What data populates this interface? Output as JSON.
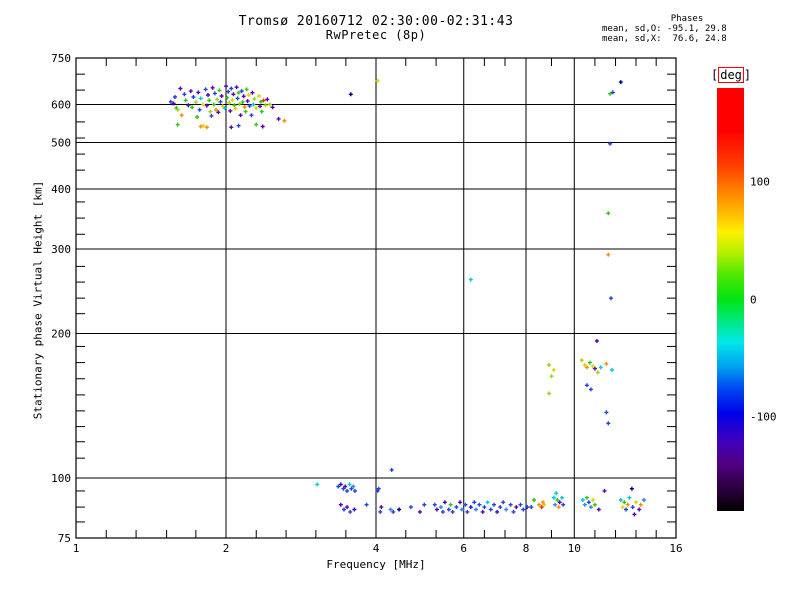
{
  "header": {
    "title_line1": "Tromsø 20160712 02:30:00-02:31:43",
    "title_line2": "RwPretec (8p)",
    "phases": {
      "heading": "Phases",
      "line_o": "mean, sd,O: -95.1, 29.8",
      "line_x": "mean, sd,X:  76.6, 24.8"
    }
  },
  "chart_data": {
    "type": "scatter",
    "title": "Tromsø 20160712 02:30:00-02:31:43",
    "subtitle": "RwPretec (8p)",
    "xlabel": "Frequency [MHz]",
    "ylabel": "Stationary phase Virtual Height [km]",
    "x_scale": "log",
    "y_scale": "log",
    "xlim": [
      1,
      16
    ],
    "ylim": [
      75,
      750
    ],
    "grid": true,
    "x_major_ticks": [
      1,
      2,
      4,
      6,
      8,
      10,
      16
    ],
    "x_minor_ticks": [
      1.15,
      1.32,
      1.52,
      1.74,
      2.3,
      2.64,
      3.03,
      3.48,
      4.59,
      5.28,
      6.6,
      7.26,
      9,
      11,
      12.1,
      13.3,
      14.6
    ],
    "y_major_ticks": [
      750,
      600,
      500,
      400,
      300,
      200,
      100,
      75
    ],
    "y_minor_ticks": [
      694,
      643,
      552,
      511,
      473,
      438,
      376,
      348,
      322,
      276,
      256,
      237,
      220,
      188,
      174,
      161,
      149,
      138,
      128,
      119,
      110,
      94,
      87,
      81
    ],
    "colorbar": {
      "label": "[deg]",
      "unit": "deg",
      "range": [
        -180,
        180
      ],
      "ticks": [
        100,
        0,
        -100
      ],
      "gradient": [
        "#ff0000 0%",
        "#ff0000 10%",
        "#ff3c00 18%",
        "#ff7d00 24%",
        "#ffc000 30%",
        "#fff000 34%",
        "#b4f000 39%",
        "#50e800 44%",
        "#00e414 50%",
        "#00e87d 55%",
        "#00e8e8 60%",
        "#00a0f0 66%",
        "#0048f0 71%",
        "#0000e8 77%",
        "#3c00c0 83%",
        "#500080 89%",
        "#28003c 95%",
        "#000000 100%"
      ]
    },
    "marker": "plus",
    "colors": {
      "p": "#5c00b0",
      "i": "#2a10c8",
      "b": "#2442dd",
      "lb": "#2e86ee",
      "c": "#00c8e0",
      "g": "#2ec812",
      "yg": "#9cd611",
      "y": "#ddd300",
      "o": "#ff8c00",
      "r": "#e83200",
      "d": "#000080"
    },
    "series": [
      {
        "name": "stationary-phase-echoes",
        "points": [
          [
            1.55,
            608,
            "b"
          ],
          [
            1.57,
            603,
            "p"
          ],
          [
            1.58,
            622,
            "b"
          ],
          [
            1.59,
            590,
            "g"
          ],
          [
            1.6,
            585,
            "yg"
          ],
          [
            1.6,
            545,
            "g"
          ],
          [
            1.62,
            648,
            "p"
          ],
          [
            1.63,
            570,
            "o"
          ],
          [
            1.65,
            630,
            "b"
          ],
          [
            1.66,
            612,
            "g"
          ],
          [
            1.68,
            598,
            "p"
          ],
          [
            1.7,
            640,
            "p"
          ],
          [
            1.71,
            592,
            "g"
          ],
          [
            1.72,
            622,
            "b"
          ],
          [
            1.74,
            607,
            "yg"
          ],
          [
            1.75,
            565,
            "g"
          ],
          [
            1.76,
            636,
            "p"
          ],
          [
            1.77,
            585,
            "b"
          ],
          [
            1.78,
            618,
            "c"
          ],
          [
            1.78,
            540,
            "o"
          ],
          [
            1.8,
            600,
            "y"
          ],
          [
            1.8,
            542,
            "y"
          ],
          [
            1.82,
            645,
            "b"
          ],
          [
            1.83,
            597,
            "p"
          ],
          [
            1.83,
            538,
            "o"
          ],
          [
            1.84,
            628,
            "p"
          ],
          [
            1.85,
            612,
            "g"
          ],
          [
            1.86,
            580,
            "yg"
          ],
          [
            1.87,
            568,
            "b"
          ],
          [
            1.88,
            650,
            "p"
          ],
          [
            1.89,
            600,
            "g"
          ],
          [
            1.9,
            633,
            "b"
          ],
          [
            1.91,
            585,
            "o"
          ],
          [
            1.92,
            615,
            "yg"
          ],
          [
            1.93,
            578,
            "p"
          ],
          [
            1.94,
            642,
            "g"
          ],
          [
            1.95,
            608,
            "b"
          ],
          [
            1.96,
            625,
            "p"
          ],
          [
            1.97,
            595,
            "y"
          ],
          [
            1.99,
            590,
            "c"
          ],
          [
            2.0,
            655,
            "p"
          ],
          [
            2.01,
            620,
            "g"
          ],
          [
            2.02,
            638,
            "b"
          ],
          [
            2.03,
            605,
            "yg"
          ],
          [
            2.04,
            582,
            "p"
          ],
          [
            2.05,
            648,
            "b"
          ],
          [
            2.05,
            538,
            "p"
          ],
          [
            2.06,
            613,
            "y"
          ],
          [
            2.07,
            630,
            "p"
          ],
          [
            2.08,
            598,
            "g"
          ],
          [
            2.09,
            588,
            "y"
          ],
          [
            2.1,
            652,
            "p"
          ],
          [
            2.11,
            618,
            "b"
          ],
          [
            2.12,
            635,
            "g"
          ],
          [
            2.12,
            542,
            "b"
          ],
          [
            2.13,
            602,
            "yg"
          ],
          [
            2.14,
            570,
            "p"
          ],
          [
            2.15,
            640,
            "b"
          ],
          [
            2.16,
            607,
            "g"
          ],
          [
            2.17,
            624,
            "p"
          ],
          [
            2.18,
            593,
            "o"
          ],
          [
            2.19,
            580,
            "g"
          ],
          [
            2.2,
            645,
            "g"
          ],
          [
            2.21,
            610,
            "p"
          ],
          [
            2.22,
            628,
            "y"
          ],
          [
            2.23,
            596,
            "b"
          ],
          [
            2.25,
            570,
            "b"
          ],
          [
            2.26,
            635,
            "p"
          ],
          [
            2.27,
            600,
            "c"
          ],
          [
            2.28,
            616,
            "yg"
          ],
          [
            2.3,
            590,
            "y"
          ],
          [
            2.3,
            545,
            "g"
          ],
          [
            2.33,
            625,
            "y"
          ],
          [
            2.34,
            595,
            "p"
          ],
          [
            2.35,
            608,
            "g"
          ],
          [
            2.36,
            580,
            "g"
          ],
          [
            2.37,
            540,
            "p"
          ],
          [
            2.38,
            612,
            "r"
          ],
          [
            2.4,
            598,
            "yg"
          ],
          [
            2.42,
            615,
            "p"
          ],
          [
            2.45,
            600,
            "yg"
          ],
          [
            2.48,
            592,
            "p"
          ],
          [
            2.55,
            560,
            "p"
          ],
          [
            2.62,
            555,
            "o"
          ],
          [
            3.56,
            630,
            "d"
          ],
          [
            4.03,
            672,
            "y"
          ],
          [
            6.2,
            259,
            "c"
          ],
          [
            12.4,
            668,
            "d"
          ],
          [
            11.8,
            632,
            "g"
          ],
          [
            11.95,
            636,
            "b"
          ],
          [
            11.8,
            497,
            "b"
          ],
          [
            11.7,
            356,
            "g"
          ],
          [
            11.7,
            292,
            "o"
          ],
          [
            11.85,
            237,
            "b"
          ],
          [
            11.1,
            193,
            "p"
          ],
          [
            8.9,
            172,
            "yg"
          ],
          [
            9.1,
            168,
            "y"
          ],
          [
            9.0,
            163,
            "yg"
          ],
          [
            8.9,
            150,
            "yg"
          ],
          [
            10.35,
            176,
            "yg"
          ],
          [
            10.5,
            172,
            "y"
          ],
          [
            10.6,
            170,
            "o"
          ],
          [
            10.75,
            174,
            "g"
          ],
          [
            10.9,
            171,
            "y"
          ],
          [
            11.0,
            169,
            "p"
          ],
          [
            11.15,
            166,
            "yg"
          ],
          [
            11.3,
            170,
            "c"
          ],
          [
            11.6,
            173,
            "o"
          ],
          [
            11.9,
            168,
            "c"
          ],
          [
            10.6,
            156,
            "b"
          ],
          [
            10.8,
            153,
            "b"
          ],
          [
            11.6,
            137,
            "b"
          ],
          [
            11.7,
            130,
            "b"
          ],
          [
            3.05,
            97,
            "c"
          ],
          [
            3.36,
            96,
            "b"
          ],
          [
            3.4,
            97,
            "i"
          ],
          [
            3.44,
            95,
            "b"
          ],
          [
            3.47,
            96,
            "p"
          ],
          [
            3.5,
            94,
            "b"
          ],
          [
            3.54,
            97,
            "c"
          ],
          [
            3.57,
            95,
            "b"
          ],
          [
            3.6,
            96,
            "lb"
          ],
          [
            3.63,
            94,
            "b"
          ],
          [
            3.4,
            88,
            "p"
          ],
          [
            3.45,
            86,
            "b"
          ],
          [
            3.5,
            87,
            "p"
          ],
          [
            3.55,
            85,
            "b"
          ],
          [
            3.62,
            86,
            "i"
          ],
          [
            3.83,
            88,
            "b"
          ],
          [
            4.03,
            94,
            "b"
          ],
          [
            4.05,
            95,
            "b"
          ],
          [
            4.3,
            104,
            "b"
          ],
          [
            4.1,
            87,
            "p"
          ],
          [
            4.08,
            85,
            "b"
          ],
          [
            4.28,
            86,
            "lb"
          ],
          [
            4.33,
            85,
            "b"
          ],
          [
            4.45,
            86,
            "d"
          ],
          [
            4.7,
            87,
            "b"
          ],
          [
            4.9,
            85,
            "p"
          ],
          [
            5.0,
            88,
            "b"
          ],
          [
            5.25,
            88,
            "b"
          ],
          [
            5.3,
            86,
            "p"
          ],
          [
            5.4,
            87,
            "lb"
          ],
          [
            5.45,
            85,
            "b"
          ],
          [
            5.5,
            89,
            "i"
          ],
          [
            5.6,
            86,
            "b"
          ],
          [
            5.65,
            88,
            "g"
          ],
          [
            5.7,
            85,
            "b"
          ],
          [
            5.8,
            87,
            "b"
          ],
          [
            5.9,
            89,
            "p"
          ],
          [
            5.95,
            86,
            "lb"
          ],
          [
            6.05,
            88,
            "b"
          ],
          [
            6.1,
            85,
            "b"
          ],
          [
            6.2,
            87,
            "i"
          ],
          [
            6.3,
            89,
            "b"
          ],
          [
            6.35,
            86,
            "lb"
          ],
          [
            6.45,
            88,
            "b"
          ],
          [
            6.55,
            85,
            "p"
          ],
          [
            6.6,
            87,
            "b"
          ],
          [
            6.7,
            89,
            "c"
          ],
          [
            6.8,
            86,
            "b"
          ],
          [
            6.9,
            88,
            "b"
          ],
          [
            7.0,
            85,
            "i"
          ],
          [
            7.1,
            87,
            "b"
          ],
          [
            7.2,
            89,
            "b"
          ],
          [
            7.3,
            86,
            "lb"
          ],
          [
            7.45,
            88,
            "b"
          ],
          [
            7.55,
            85,
            "b"
          ],
          [
            7.65,
            87,
            "p"
          ],
          [
            7.8,
            88,
            "b"
          ],
          [
            7.9,
            86,
            "b"
          ],
          [
            8.05,
            87,
            "b"
          ],
          [
            8.2,
            87,
            "b"
          ],
          [
            8.3,
            90,
            "g"
          ],
          [
            8.5,
            88,
            "o"
          ],
          [
            8.6,
            87,
            "r"
          ],
          [
            8.65,
            89,
            "o"
          ],
          [
            8.7,
            88,
            "y"
          ],
          [
            9.1,
            91,
            "c"
          ],
          [
            9.15,
            88,
            "lb"
          ],
          [
            9.2,
            93,
            "c"
          ],
          [
            9.25,
            90,
            "g"
          ],
          [
            9.3,
            87,
            "o"
          ],
          [
            9.35,
            89,
            "p"
          ],
          [
            9.45,
            91,
            "c"
          ],
          [
            9.5,
            88,
            "b"
          ],
          [
            10.4,
            90,
            "c"
          ],
          [
            10.5,
            88,
            "lb"
          ],
          [
            10.6,
            91,
            "g"
          ],
          [
            10.7,
            89,
            "b"
          ],
          [
            10.8,
            87,
            "lb"
          ],
          [
            10.9,
            90,
            "y"
          ],
          [
            11.0,
            88,
            "g"
          ],
          [
            11.2,
            86,
            "p"
          ],
          [
            11.5,
            94,
            "p"
          ],
          [
            13.05,
            95,
            "d"
          ],
          [
            12.4,
            90,
            "c"
          ],
          [
            12.5,
            87,
            "y"
          ],
          [
            12.6,
            89,
            "g"
          ],
          [
            12.7,
            86,
            "b"
          ],
          [
            12.8,
            88,
            "o"
          ],
          [
            12.9,
            91,
            "c"
          ],
          [
            13.1,
            87,
            "b"
          ],
          [
            13.3,
            89,
            "y"
          ],
          [
            13.5,
            86,
            "p"
          ],
          [
            13.2,
            84,
            "p"
          ],
          [
            13.6,
            88,
            "o"
          ],
          [
            13.8,
            90,
            "lb"
          ]
        ]
      }
    ]
  }
}
